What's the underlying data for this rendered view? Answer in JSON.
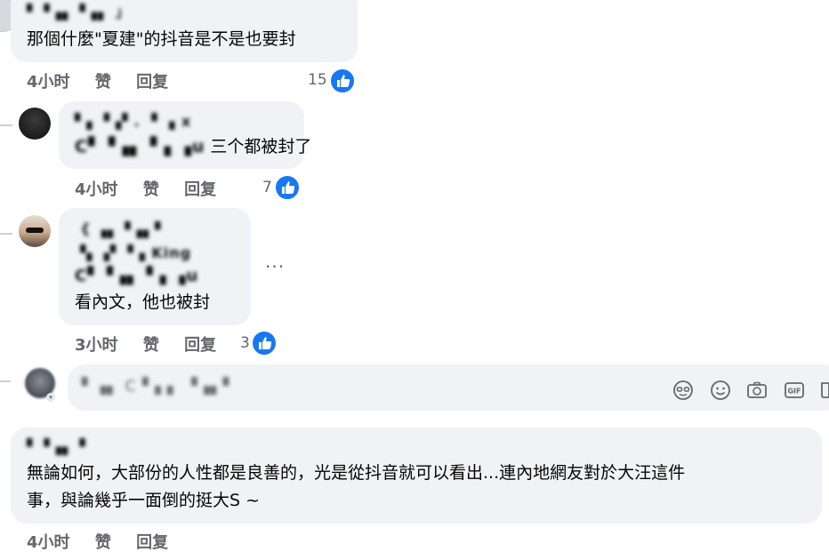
{
  "comments": [
    {
      "author": "▘▝▗▖▝▗▖ 」",
      "text_lines": [
        "那個什麼\"夏建\"的抖音是不是也要封"
      ],
      "time": "4小时",
      "like_label": "赞",
      "reply_label": "回复",
      "like_count": "15"
    },
    {
      "author": "▘▖▝▗▘. ▝ ▗ x",
      "mention": "C▘▝▗▖▝ ▖▗u",
      "text_lines": [
        "三个都被封了"
      ],
      "time": "4小时",
      "like_label": "赞",
      "reply_label": "回复",
      "like_count": "7"
    },
    {
      "author_line1": "《 ▗▖▝▗▖▘",
      "author_line2": "▝▖▗▘▝▗ King",
      "mention": "C▘▝▗▖▝ ▖▗u",
      "text_lines": [
        "看內文，他也被封"
      ],
      "time": "3小时",
      "like_label": "赞",
      "reply_label": "回复",
      "like_count": "3",
      "more_label": "···"
    },
    {
      "author": "▘▝▗▖▝",
      "text_lines": [
        "無論如何，大部份的人性都是良善的，光是從抖音就可以看出...連內地網友對於大汪這件",
        "事，與論幾乎一面倒的挺大S ~"
      ],
      "time": "4小时",
      "like_label": "赞",
      "reply_label": "回复"
    }
  ],
  "reply_input": {
    "placeholder": "▘▗▖ C▝▗ ▖ ▝▗▖▘"
  },
  "icons": [
    "avatar-mask-icon",
    "emoji-icon",
    "camera-icon",
    "gif-icon",
    "sticker-icon",
    "like-icon"
  ],
  "colors": {
    "bubble": "#f0f2f5",
    "like_blue": "#1877f2",
    "meta_gray": "#65676b"
  }
}
